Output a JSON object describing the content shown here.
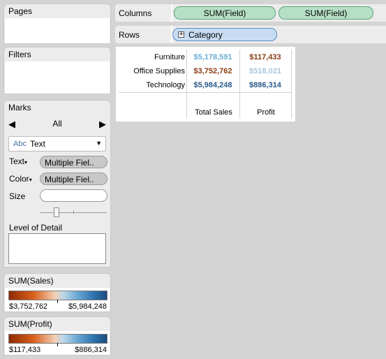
{
  "panels": {
    "pages": {
      "title": "Pages"
    },
    "filters": {
      "title": "Filters"
    },
    "marks": {
      "title": "Marks",
      "nav": {
        "left": "◀",
        "label": "All",
        "right": "▶"
      },
      "mark_type": {
        "icon_text": "Abc",
        "value": "Text",
        "dropdown": "▼"
      },
      "encodings": [
        {
          "label": "Text",
          "caret": "▾",
          "pill": "Multiple Fiel.."
        },
        {
          "label": "Color",
          "caret": "▾",
          "pill": "Multiple Fiel.."
        },
        {
          "label": "Size",
          "caret": "",
          "pill": ""
        }
      ],
      "size_level": 0.25,
      "level_of_detail": "Level of Detail"
    }
  },
  "legends": [
    {
      "title": "SUM(Sales)",
      "min": "$3,752,762",
      "max": "$5,984,248"
    },
    {
      "title": "SUM(Profit)",
      "min": "$117,433",
      "max": "$886,314"
    }
  ],
  "shelves": {
    "columns": {
      "label": "Columns",
      "pills": [
        "SUM(Field)",
        "SUM(Field)"
      ]
    },
    "rows": {
      "label": "Rows",
      "pills": [
        "Category"
      ],
      "expand_icon": "+"
    }
  },
  "table": {
    "rows": [
      {
        "category": "Furniture",
        "sales": "$5,178,591",
        "profit": "$117,433",
        "sales_color": "#6aaed6",
        "profit_color": "#8a3c12"
      },
      {
        "category": "Office Supplies",
        "sales": "$3,752,762",
        "profit": "$518,021",
        "sales_color": "#8a3c12",
        "profit_color": "#a9c6de"
      },
      {
        "category": "Technology",
        "sales": "$5,984,248",
        "profit": "$886,314",
        "sales_color": "#2a5a8a",
        "profit_color": "#2a5a8a"
      }
    ],
    "col_headers": [
      "Total Sales",
      "Profit"
    ]
  }
}
